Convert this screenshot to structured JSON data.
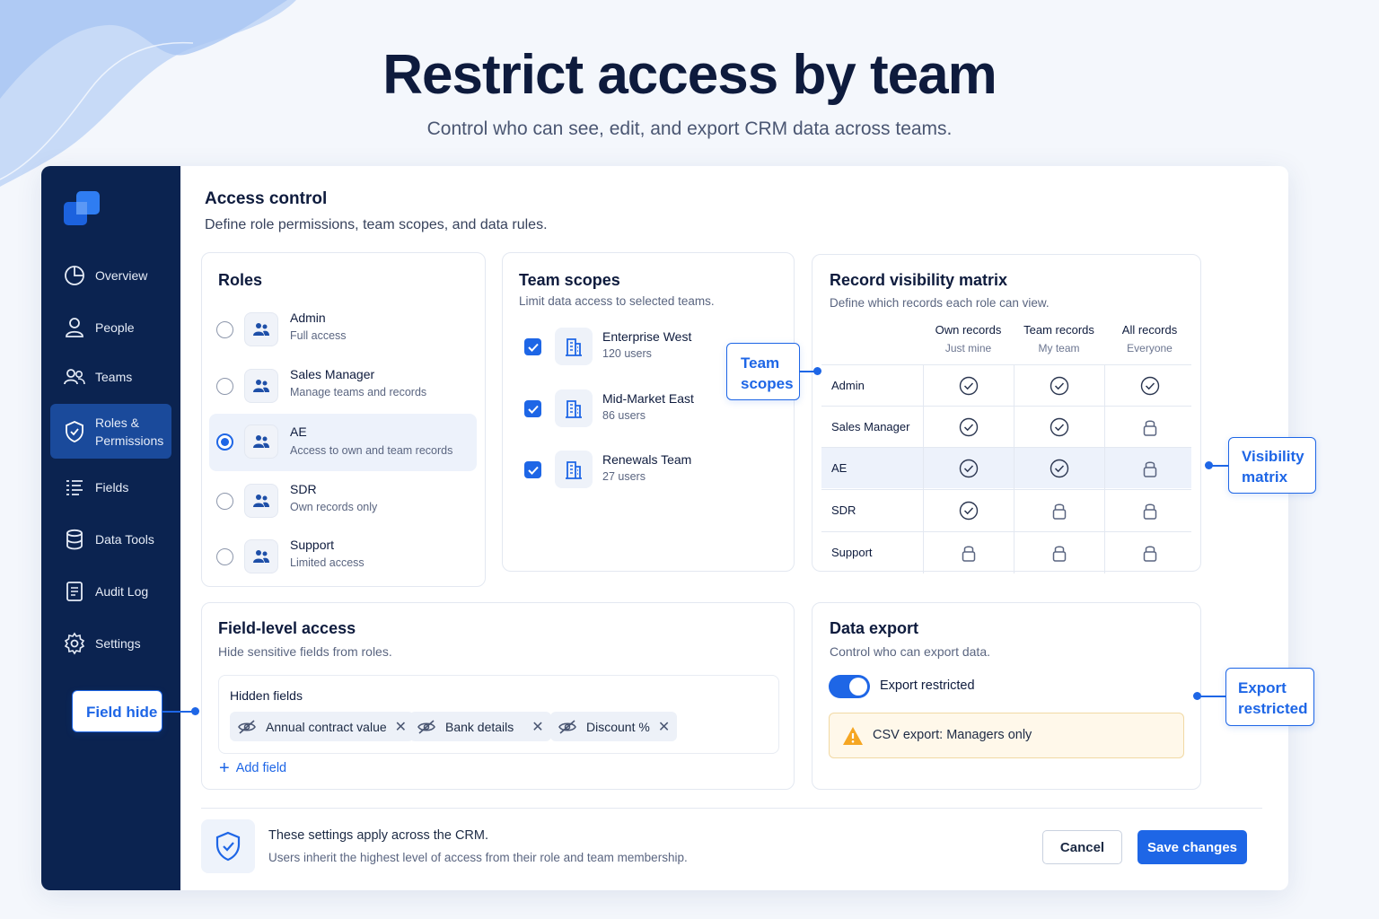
{
  "hero": {
    "title": "Restrict access by team",
    "subtitle": "Control who can see, edit, and export CRM data across teams."
  },
  "sidebar": {
    "items": [
      {
        "label": "Overview",
        "icon": "pie-chart-icon"
      },
      {
        "label": "People",
        "icon": "person-icon"
      },
      {
        "label": "Teams",
        "icon": "users-icon"
      },
      {
        "label": "Roles & Permissions",
        "icon": "shield-check-icon",
        "active": true
      },
      {
        "label": "Fields",
        "icon": "list-icon"
      },
      {
        "label": "Data Tools",
        "icon": "database-icon"
      },
      {
        "label": "Audit Log",
        "icon": "document-icon"
      },
      {
        "label": "Settings",
        "icon": "gear-icon"
      }
    ]
  },
  "callouts": {
    "field_hide": "Field hide",
    "team_scopes": "Team scopes",
    "visibility_matrix": "Visibility matrix",
    "export_restricted": "Export restricted"
  },
  "main": {
    "title": "Access control",
    "subtitle": "Define role permissions, team scopes, and data rules."
  },
  "roles": {
    "title": "Roles",
    "items": [
      {
        "name": "Admin",
        "desc": "Full access",
        "selected": false
      },
      {
        "name": "Sales Manager",
        "desc": "Manage teams and records",
        "selected": false
      },
      {
        "name": "AE",
        "desc": "Access to own and team records",
        "selected": true
      },
      {
        "name": "SDR",
        "desc": "Own records only",
        "selected": false
      },
      {
        "name": "Support",
        "desc": "Limited access",
        "selected": false
      }
    ]
  },
  "team_scopes": {
    "title": "Team scopes",
    "subtitle": "Limit data access to selected teams.",
    "teams": [
      {
        "name": "Enterprise West",
        "count": "120 users",
        "checked": true
      },
      {
        "name": "Mid-Market East",
        "count": "86 users",
        "checked": true
      },
      {
        "name": "Renewals Team",
        "count": "27 users",
        "checked": true
      }
    ]
  },
  "matrix": {
    "title": "Record visibility matrix",
    "subtitle": "Define which records each role can view.",
    "columns": [
      {
        "label": "Own records",
        "sub": "Just mine"
      },
      {
        "label": "Team records",
        "sub": "My team"
      },
      {
        "label": "All records",
        "sub": "Everyone"
      }
    ],
    "rows": [
      {
        "role": "Admin",
        "cells": [
          "check",
          "check",
          "check"
        ]
      },
      {
        "role": "Sales Manager",
        "cells": [
          "check",
          "check",
          "lock"
        ]
      },
      {
        "role": "AE",
        "cells": [
          "check",
          "check",
          "lock"
        ],
        "selected": true
      },
      {
        "role": "SDR",
        "cells": [
          "check",
          "lock",
          "lock"
        ]
      },
      {
        "role": "Support",
        "cells": [
          "lock",
          "lock",
          "lock"
        ]
      }
    ]
  },
  "field_access": {
    "title": "Field-level access",
    "subtitle": "Hide sensitive fields from roles.",
    "hidden_label": "Hidden fields",
    "chips": [
      "Annual contract value",
      "Bank details",
      "Discount %"
    ],
    "add_label": "Add field"
  },
  "export": {
    "title": "Data export",
    "subtitle": "Control who can export data.",
    "toggle_label": "Export restricted",
    "toggle_on": true,
    "warning": "CSV export: Managers only"
  },
  "footer": {
    "title": "These settings apply across the CRM.",
    "sub": "Users inherit the highest level of access from their role and team membership.",
    "cancel": "Cancel",
    "save": "Save changes"
  },
  "colors": {
    "accent": "#1e66e6",
    "sidebar": "#0b2350",
    "sidebar_active": "#1a4a9b",
    "warning_bg": "#fff8ea"
  }
}
